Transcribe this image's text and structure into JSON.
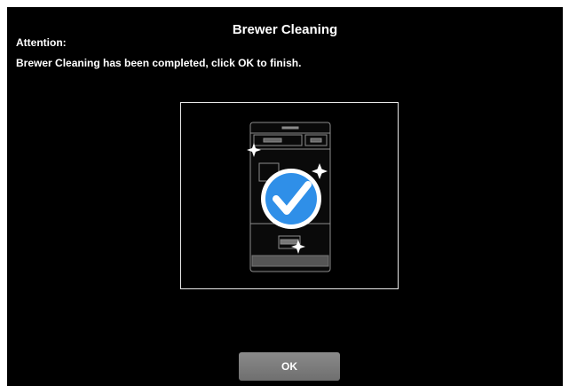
{
  "dialog": {
    "title": "Brewer Cleaning",
    "attention_label": "Attention:",
    "message": "Brewer Cleaning has been completed, click OK to finish."
  },
  "illustration": {
    "icons": [
      "brewer-machine-icon",
      "checkmark-icon",
      "sparkle-icon"
    ],
    "accent_color": "#2f8fe8"
  },
  "actions": {
    "ok_label": "OK"
  },
  "colors": {
    "background": "#000000",
    "text": "#ffffff",
    "button": "#7a7a7a"
  }
}
